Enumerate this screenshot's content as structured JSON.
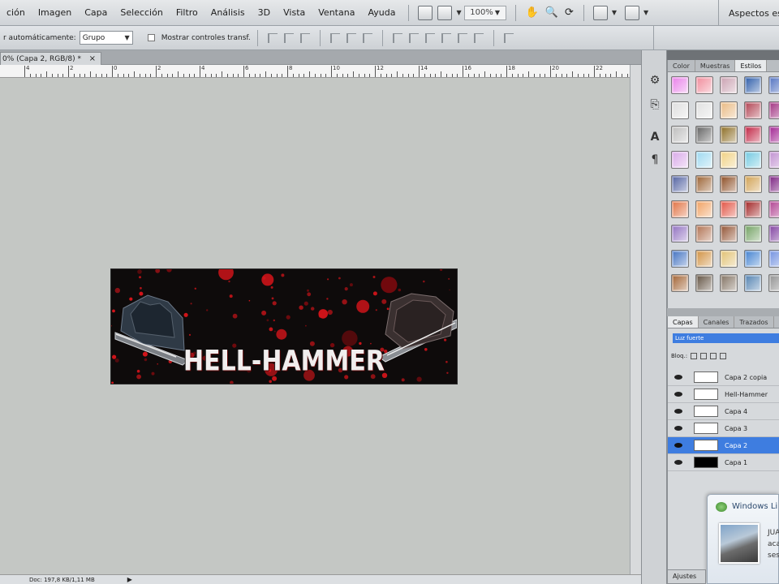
{
  "menubar": {
    "items": [
      "ción",
      "Imagen",
      "Capa",
      "Selección",
      "Filtro",
      "Análisis",
      "3D",
      "Vista",
      "Ventana",
      "Ayuda"
    ],
    "zoom": "100%",
    "workspace": "Aspectos esen"
  },
  "options": {
    "auto_select_label": "r automáticamente:",
    "auto_select_value": "Grupo",
    "show_transform_label": "Mostrar controles transf."
  },
  "document": {
    "tab_label": "0% (Capa 2, RGB/8) *",
    "tab_close": "×",
    "status": "Doc: 197,8 KB/1,11 MB",
    "status_arrow": "▶"
  },
  "ruler": {
    "labels": [
      "4",
      "2",
      "0",
      "2",
      "4",
      "6",
      "8",
      "10",
      "12",
      "14",
      "16",
      "18",
      "20",
      "22"
    ]
  },
  "banner": {
    "title": "HELL-HAMMER"
  },
  "styles_panel": {
    "tabs": [
      "Color",
      "Muestras",
      "Estilos"
    ],
    "active_tab": "Estilos",
    "swatch_colors": [
      "#e880e8",
      "#f08a9a",
      "#c9a0b0",
      "#2a5aa8",
      "#5070c0",
      "#dedede",
      "#e0e0e0",
      "#e8b880",
      "#b04050",
      "#a03080",
      "#bcbcbc",
      "#606060",
      "#8a6a20",
      "#c02040",
      "#a02090",
      "#d8a8e8",
      "#9cd8f0",
      "#f0d080",
      "#70c8e0",
      "#c090d0",
      "#5060a0",
      "#9a6030",
      "#8a4a20",
      "#d0a050",
      "#7a2080",
      "#e07040",
      "#f0a060",
      "#e05040",
      "#a02020",
      "#b04090",
      "#9070c0",
      "#b07050",
      "#905030",
      "#70a060",
      "#8040a0",
      "#4070c0",
      "#d09040",
      "#e0c070",
      "#4080d0",
      "#7090e0",
      "#a06030",
      "#605040",
      "#807060",
      "#5080b0",
      "#909090"
    ]
  },
  "layers_panel": {
    "tabs": [
      "Capas",
      "Canales",
      "Trazados"
    ],
    "active_tab": "Capas",
    "blend_mode": "Luz fuerte",
    "lock_label": "Bloq.:",
    "layers": [
      {
        "name": "Capa 2 copia",
        "selected": false,
        "thumb": "#ffffff"
      },
      {
        "name": "Hell-Hammer",
        "selected": false,
        "thumb": "#ffffff"
      },
      {
        "name": "Capa 4",
        "selected": false,
        "thumb": "#ffffff"
      },
      {
        "name": "Capa 3",
        "selected": false,
        "thumb": "#ffffff"
      },
      {
        "name": "Capa 2",
        "selected": true,
        "thumb": "#ffffff"
      },
      {
        "name": "Capa 1",
        "selected": false,
        "thumb": "#000000"
      }
    ],
    "layer_selected_color": "#3e7de0"
  },
  "notification": {
    "title": "Windows Li",
    "lines": [
      "JUA",
      "aca",
      "ses"
    ]
  },
  "bottom_tab": "Ajustes"
}
